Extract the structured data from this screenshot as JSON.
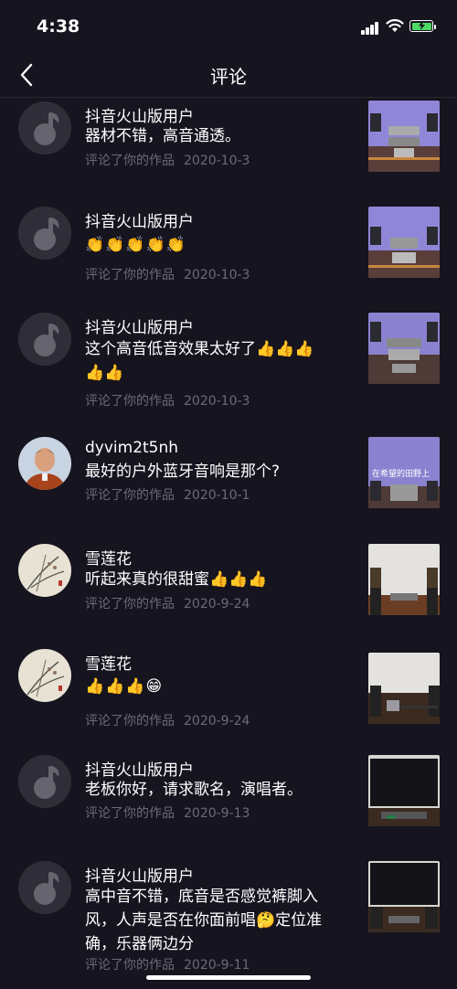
{
  "status": {
    "time": "4:38"
  },
  "nav": {
    "title": "评论"
  },
  "comments": [
    {
      "user": "抖音火山版用户",
      "text": "器材不错，高音通透。",
      "action": "评论了你的作品",
      "date": "2020-10-3"
    },
    {
      "user": "抖音火山版用户",
      "text": "👏👏👏👏👏",
      "action": "评论了你的作品",
      "date": "2020-10-3"
    },
    {
      "user": "抖音火山版用户",
      "text": "这个高音低音效果太好了👍👍👍👍👍",
      "action": "评论了你的作品",
      "date": "2020-10-3"
    },
    {
      "user": "dyvim2t5nh",
      "text": "最好的户外蓝牙音响是那个?",
      "action": "评论了你的作品",
      "date": "2020-10-1",
      "thumb_caption": "在希望的田野上"
    },
    {
      "user": "雪莲花",
      "text": "听起来真的很甜蜜👍👍👍",
      "action": "评论了你的作品",
      "date": "2020-9-24"
    },
    {
      "user": "雪莲花",
      "text": "👍👍👍😁",
      "action": "评论了你的作品",
      "date": "2020-9-24"
    },
    {
      "user": "抖音火山版用户",
      "text": "老板你好，请求歌名，演唱者。",
      "action": "评论了你的作品",
      "date": "2020-9-13"
    },
    {
      "user": "抖音火山版用户",
      "text": "高中音不错，底音是否感觉裤脚入风，人声是否在你面前唱🤔定位准确，乐器俩边分",
      "action": "评论了你的作品",
      "date": "2020-9-11"
    }
  ]
}
